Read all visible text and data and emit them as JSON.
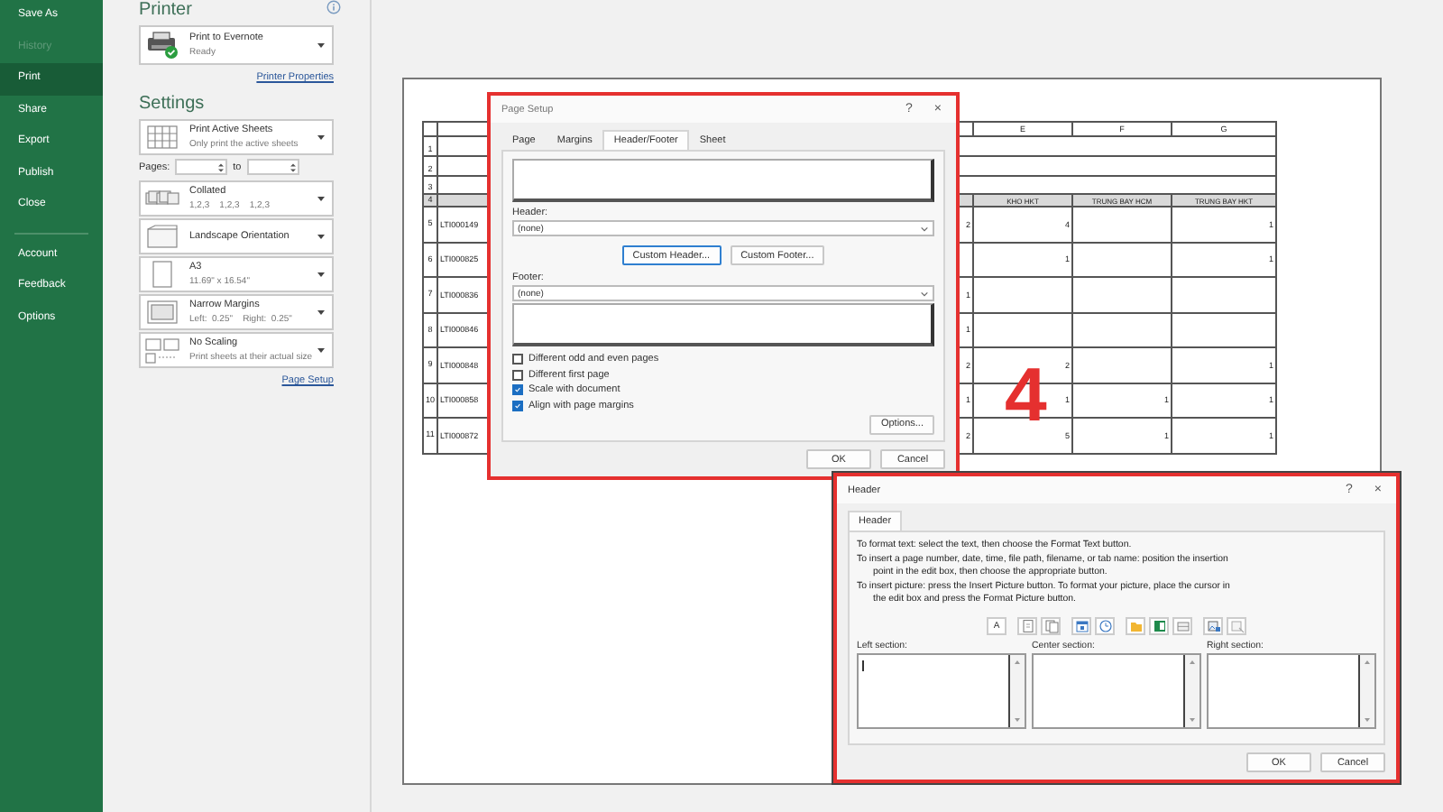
{
  "sidebar": {
    "items": [
      {
        "label": "Save As",
        "selected": false,
        "disabled": false
      },
      {
        "label": "History",
        "selected": false,
        "disabled": true
      },
      {
        "label": "Print",
        "selected": true,
        "disabled": false
      },
      {
        "label": "Share",
        "selected": false,
        "disabled": false
      },
      {
        "label": "Export",
        "selected": false,
        "disabled": false
      },
      {
        "label": "Publish",
        "selected": false,
        "disabled": false
      },
      {
        "label": "Close",
        "selected": false,
        "disabled": false
      }
    ],
    "bottom_items": [
      {
        "label": "Account",
        "selected": false,
        "disabled": false
      },
      {
        "label": "Feedback",
        "selected": false,
        "disabled": false
      },
      {
        "label": "Options",
        "selected": false,
        "disabled": false
      }
    ]
  },
  "print_panel": {
    "printer_heading": "Printer",
    "printer": {
      "name": "Print to Evernote",
      "status": "Ready"
    },
    "printer_properties": "Printer Properties",
    "settings_heading": "Settings",
    "settings": [
      {
        "kind": "dropdown",
        "title": "Print Active Sheets",
        "subtitle": "Only print the active sheets"
      },
      {
        "kind": "pages",
        "label": "Pages:",
        "to_label": "to"
      },
      {
        "kind": "dropdown",
        "title": "Collated",
        "subtitle": "1,2,3    1,2,3    1,2,3"
      },
      {
        "kind": "dropdown",
        "title": "Landscape Orientation"
      },
      {
        "kind": "dropdown",
        "title": "A3",
        "subtitle": "11.69\" x 16.54\""
      },
      {
        "kind": "dropdown",
        "title": "Narrow Margins",
        "subtitle": "Left:  0.25\"    Right:  0.25\""
      },
      {
        "kind": "dropdown",
        "title": "No Scaling",
        "subtitle": "Print sheets at their actual size"
      }
    ],
    "page_setup_link": "Page Setup"
  },
  "sheet": {
    "column_letters": {
      "E": "E",
      "F": "F",
      "G": "G"
    },
    "rows": [
      {
        "kind": "title",
        "number": "1"
      },
      {
        "kind": "title",
        "number": "2"
      },
      {
        "kind": "title",
        "number": "3"
      },
      {
        "kind": "heading",
        "number": "4",
        "E": "KHO HKT",
        "F": "TRUNG BAY HCM",
        "G": "TRUNG BAY HKT"
      },
      {
        "kind": "data",
        "number": "5",
        "code": "LTI000149",
        "D": "2",
        "E": "4",
        "G": "1"
      },
      {
        "kind": "data",
        "number": "6",
        "code": "LTI000825",
        "E": "1",
        "G": "1"
      },
      {
        "kind": "data",
        "number": "7",
        "code": "LTI000836",
        "D": "1"
      },
      {
        "kind": "data",
        "number": "8",
        "code": "LTI000846",
        "D": "1"
      },
      {
        "kind": "data",
        "number": "9",
        "code": "LTI000848",
        "D": "2",
        "E": "2",
        "G": "1"
      },
      {
        "kind": "data",
        "number": "10",
        "code": "LTI000858",
        "D": "1",
        "E": "1",
        "F": "1",
        "G": "1"
      },
      {
        "kind": "data",
        "number": "11",
        "code": "LTI000872",
        "D": "2",
        "E": "5",
        "F": "1",
        "G": "1"
      }
    ]
  },
  "page_setup": {
    "title": "Page Setup",
    "help": "?",
    "close": "×",
    "tabs": [
      {
        "label": "Page",
        "selected": false
      },
      {
        "label": "Margins",
        "selected": false
      },
      {
        "label": "Header/Footer",
        "selected": true
      },
      {
        "label": "Sheet",
        "selected": false
      }
    ],
    "header_label": "Header:",
    "header_value": "(none)",
    "custom_header": "Custom Header...",
    "custom_footer": "Custom Footer...",
    "footer_label": "Footer:",
    "footer_value": "(none)",
    "checkboxes": [
      {
        "label": "Different odd and even pages",
        "checked": false
      },
      {
        "label": "Different first page",
        "checked": false
      },
      {
        "label": "Scale with document",
        "checked": true
      },
      {
        "label": "Align with page margins",
        "checked": true
      }
    ],
    "options": "Options...",
    "ok": "OK",
    "cancel": "Cancel"
  },
  "step_number": "4",
  "header_dialog": {
    "title": "Header",
    "help": "?",
    "close": "×",
    "tabs": [
      {
        "label": "Header",
        "selected": true
      }
    ],
    "instructions": [
      "To format text:  select the text, then choose the Format Text button.",
      "To insert a page number, date, time, file path, filename, or tab name:  position the insertion point in the edit box, then choose the appropriate button.",
      "To insert picture: press the Insert Picture button.  To format your picture, place the cursor in the edit box and press the Format Picture button."
    ],
    "format_text_button": "A",
    "sections": [
      {
        "label": "Left section:"
      },
      {
        "label": "Center section:"
      },
      {
        "label": "Right section:"
      }
    ],
    "ok": "OK",
    "cancel": "Cancel"
  }
}
